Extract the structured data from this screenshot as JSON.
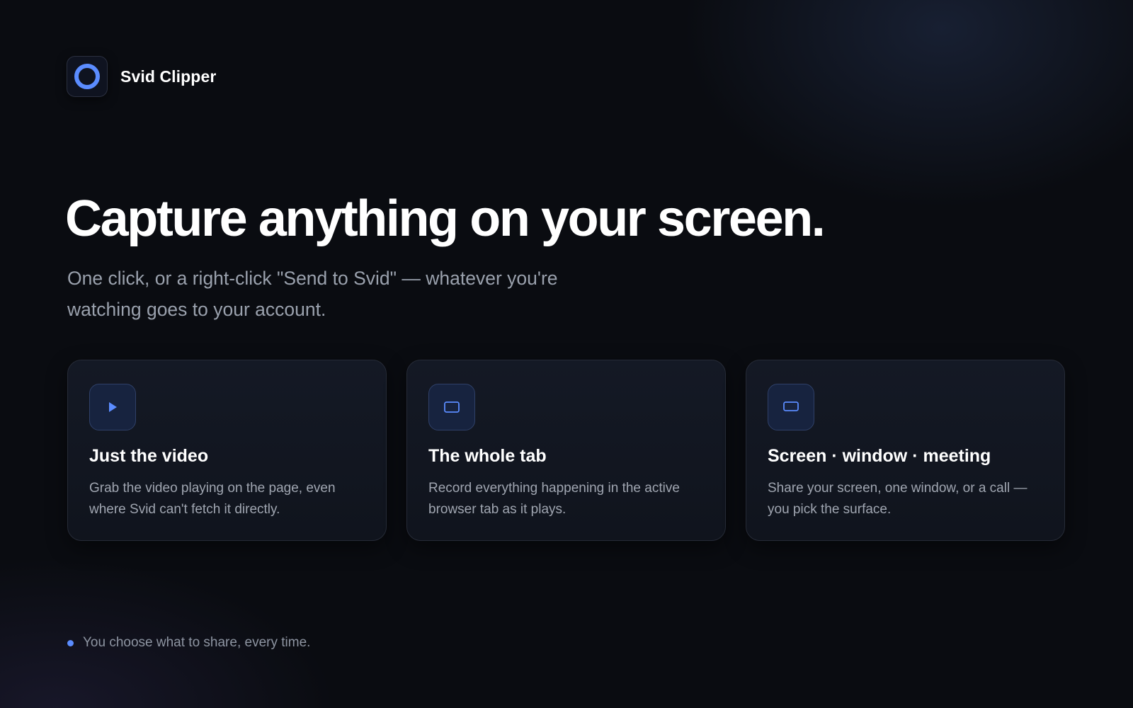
{
  "brand": {
    "name": "Svid Clipper",
    "logo_icon": "ring-logo-icon",
    "accent_color": "#5b8cff"
  },
  "hero": {
    "title": "Capture anything on your screen.",
    "subtitle": "One click, or a right-click \"Send to Svid\" — whatever you're watching goes to your account."
  },
  "cards": [
    {
      "icon": "play-icon",
      "title": "Just the video",
      "description": "Grab the video playing on the page, even where Svid can't fetch it directly."
    },
    {
      "icon": "tab-icon",
      "title": "The whole tab",
      "description": "Record everything happening in the active browser tab as it plays."
    },
    {
      "icon": "screen-icon",
      "title": "Screen · window · meeting",
      "description": "Share your screen, one window, or a call — you pick the surface."
    }
  ],
  "footer": {
    "note": "You choose what to share, every time."
  }
}
